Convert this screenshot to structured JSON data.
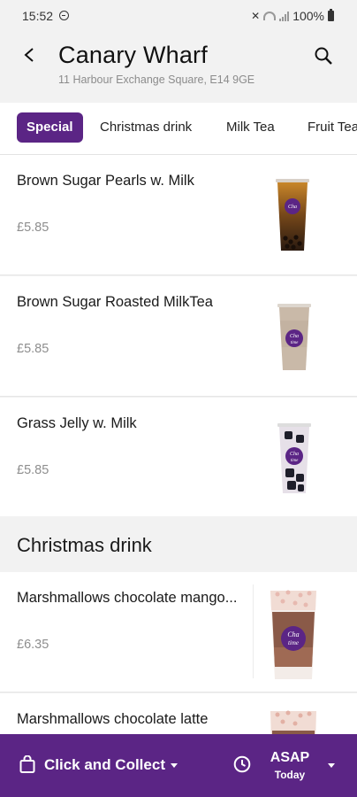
{
  "status_bar": {
    "time": "15:52",
    "battery": "100%"
  },
  "header": {
    "title": "Canary Wharf",
    "address": "11 Harbour Exchange Square, E14 9GE"
  },
  "tabs": [
    {
      "label": "Special"
    },
    {
      "label": "Christmas drink"
    },
    {
      "label": "Milk Tea"
    },
    {
      "label": "Fruit Tea"
    }
  ],
  "items": [
    {
      "name": "Brown Sugar Pearls w. Milk",
      "price": "£5.85",
      "image": "brown-sugar-pearls-drink"
    },
    {
      "name": "Brown Sugar Roasted MilkTea",
      "price": "£5.85",
      "image": "roasted-milk-tea-drink"
    },
    {
      "name": "Grass Jelly w. Milk",
      "price": "£5.85",
      "image": "grass-jelly-drink"
    }
  ],
  "section": {
    "title": "Christmas drink"
  },
  "christmas_items": [
    {
      "name": "Marshmallows chocolate mango...",
      "price": "£6.35",
      "image": "marshmallow-chocolate-drink"
    },
    {
      "name": "Marshmallows chocolate latte",
      "price": "",
      "image": "marshmallow-latte-drink"
    }
  ],
  "bottom_bar": {
    "order_mode": "Click and Collect",
    "time_main": "ASAP",
    "time_sub": "Today"
  },
  "colors": {
    "brand": "#5b2585",
    "background": "#f2f2f2"
  }
}
